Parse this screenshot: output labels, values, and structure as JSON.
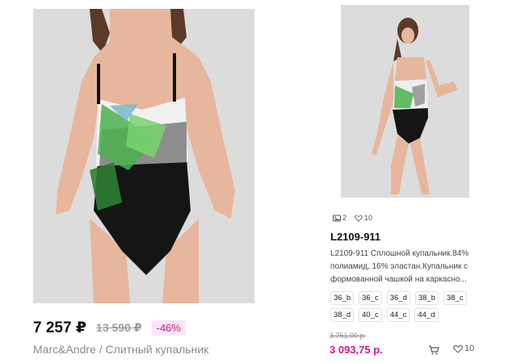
{
  "left_card": {
    "price": "7 257 ₽",
    "old_price": "13 590 ₽",
    "discount": "-46%",
    "subtitle": "Marc&Andre / Слитный купальник"
  },
  "right_card": {
    "photos_count": "2",
    "likes_count": "10",
    "sku": "L2109-911",
    "description": "L2109-911 Сплошной купальник.84% полиамид, 16% эластан.Купальник с формованной чашкой на каркасно...",
    "sizes": [
      "36_b",
      "36_c",
      "36_d",
      "38_b",
      "38_c",
      "38_d",
      "40_c",
      "44_c",
      "44_d"
    ],
    "old_price": "3 751,00 р.",
    "price": "3 093,75 р.",
    "favorites_count": "10"
  },
  "icons": {
    "photos": "image-icon",
    "likes": "heart-icon",
    "cart": "cart-icon",
    "favorite": "heart-icon"
  }
}
